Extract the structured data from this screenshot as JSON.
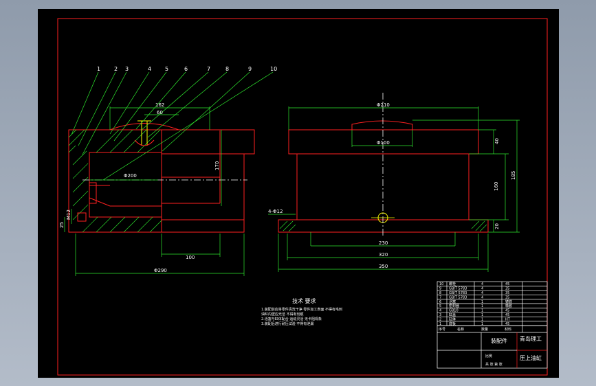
{
  "colors": {
    "background": "#000000",
    "viewport_bg": "#aab4c2",
    "border": "#ff2020",
    "outline": "#ff2020",
    "dimension": "#2ee82e",
    "hatch": "#2ee82e",
    "centerline": "#ffffff",
    "bolt": "#ffff00",
    "text": "#ffffff"
  },
  "balloons": [
    "1",
    "2",
    "3",
    "4",
    "5",
    "6",
    "7",
    "8",
    "9",
    "10"
  ],
  "left_view": {
    "dim_top_1": "162",
    "dim_top_2": "60",
    "dim_dia": "Φ200",
    "dim_height": "170",
    "dim_bottom": "100",
    "dim_overall": "Φ290",
    "dim_left_1": "25",
    "dim_left_2": "M12"
  },
  "right_view": {
    "dim_top": "Φ210",
    "dim_inner": "Φ100",
    "dim_h1": "40",
    "dim_h2": "160",
    "dim_h3": "185",
    "dim_h4": "20",
    "dim_bolt": "4-Φ12",
    "dim_w1": "230",
    "dim_w2": "320",
    "dim_w3": "350"
  },
  "notes": {
    "heading": "技术 要求",
    "lines": [
      "1.装配前应将零件清洗干净 零件加工表面 不得有毛刺",
      "  油缸内壁应光洁 不得有划痕",
      "2.活塞与缸体配合 运动灵活 无卡阻现象",
      "3.装配后进行耐压试验 不得有泄漏"
    ]
  },
  "title_block": {
    "rows": [
      {
        "no": "10",
        "name": "螺栓",
        "qty": "4",
        "mat": "45"
      },
      {
        "no": "9",
        "name": "GB/T 5783",
        "qty": "4",
        "mat": "35"
      },
      {
        "no": "8",
        "name": "GB/T 5783",
        "qty": "4",
        "mat": "35"
      },
      {
        "no": "7",
        "name": "GB/T 5783",
        "qty": "4",
        "mat": "35"
      },
      {
        "no": "6",
        "name": "活塞",
        "qty": "1",
        "mat": "铸铁"
      },
      {
        "no": "5",
        "name": "密封圈",
        "qty": "1",
        "mat": "橡胶"
      },
      {
        "no": "4",
        "name": "GB10",
        "qty": "1",
        "mat": "45"
      },
      {
        "no": "3",
        "name": "缸盖",
        "qty": "1",
        "mat": "45"
      },
      {
        "no": "2",
        "name": "缸体",
        "qty": "1",
        "mat": "HT"
      },
      {
        "no": "1",
        "name": "底板",
        "qty": "1",
        "mat": "45"
      }
    ],
    "header_no": "序号",
    "header_name": "名称",
    "header_qty": "数量",
    "header_mat": "材料",
    "drawing_label": "装配件",
    "school": "青岛理工",
    "part_name": "压上油缸",
    "scale": "比例",
    "sheet": "共 张 第 张"
  }
}
